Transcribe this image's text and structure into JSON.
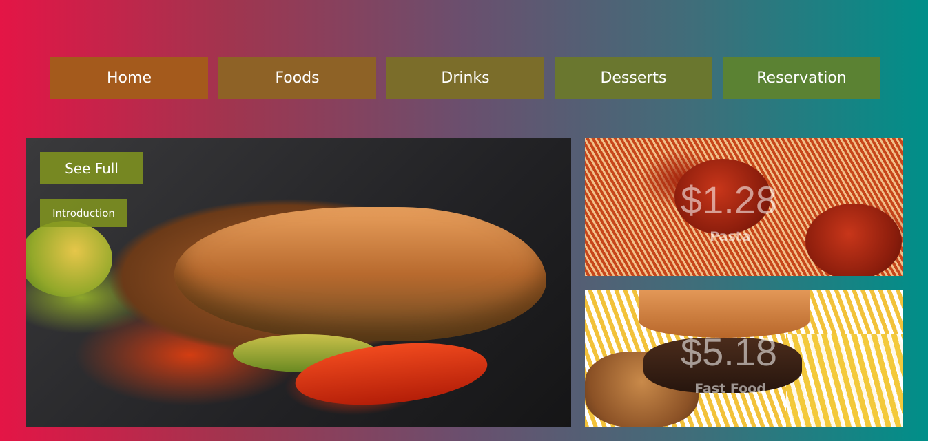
{
  "nav": {
    "items": [
      {
        "label": "Home"
      },
      {
        "label": "Foods"
      },
      {
        "label": "Drinks"
      },
      {
        "label": "Desserts"
      },
      {
        "label": "Reservation"
      }
    ]
  },
  "hero": {
    "see_full_label": "See Full",
    "intro_label": "Introduction"
  },
  "cards": [
    {
      "price": "$1.28",
      "label": "Pasta"
    },
    {
      "price": "$5.18",
      "label": "Fast Food"
    }
  ],
  "colors": {
    "gradient_left": "#e41546",
    "gradient_right": "#008f89",
    "button_green": "#82961e"
  }
}
